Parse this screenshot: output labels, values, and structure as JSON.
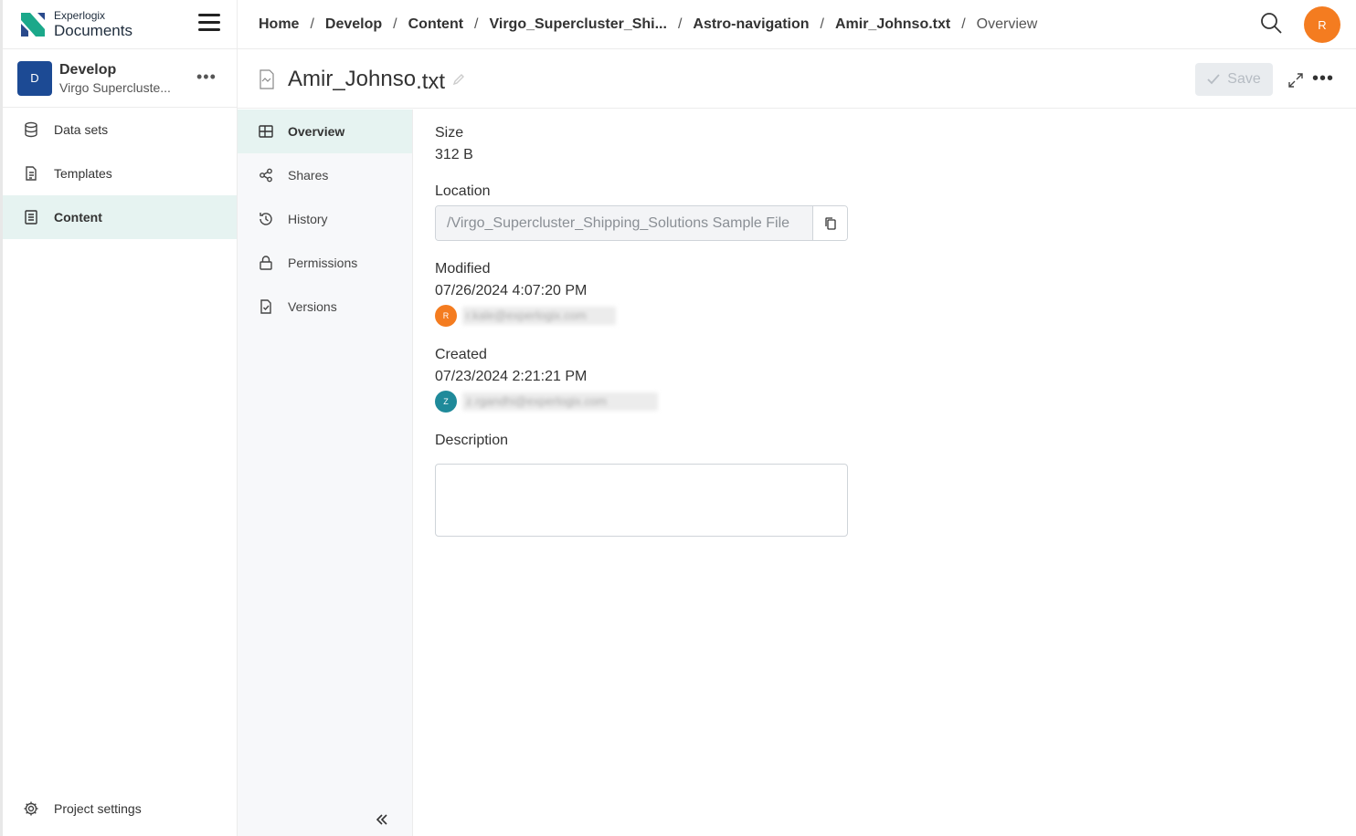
{
  "brand": {
    "line1": "Experlogix",
    "line2": "Documents"
  },
  "project": {
    "initial": "D",
    "title": "Develop",
    "subtitle": "Virgo Superclust​e..."
  },
  "sidebar": {
    "items": [
      {
        "label": "Data sets",
        "icon": "database-icon"
      },
      {
        "label": "Templates",
        "icon": "document-icon"
      },
      {
        "label": "Content",
        "icon": "content-icon",
        "active": true
      }
    ],
    "bottom": {
      "label": "Project settings",
      "icon": "gear-icon"
    }
  },
  "breadcrumb": [
    "Home",
    "Develop",
    "Content",
    "Virgo_Supercluster_Shi...",
    "Astro-navigation",
    "Amir_Johnso.txt",
    "Overview"
  ],
  "user": {
    "initial": "R"
  },
  "file": {
    "name": "Amir_Johnso",
    "ext": ".txt"
  },
  "toolbar": {
    "save_label": "Save"
  },
  "subnav": {
    "items": [
      {
        "label": "Overview",
        "active": true
      },
      {
        "label": "Shares"
      },
      {
        "label": "History"
      },
      {
        "label": "Permissions"
      },
      {
        "label": "Versions"
      }
    ]
  },
  "details": {
    "size_label": "Size",
    "size_value": "312 B",
    "location_label": "Location",
    "location_value": "/Virgo_Supercluster_Shipping_Solutions Sample File",
    "modified_label": "Modified",
    "modified_value": "07/26/2024 4:07:20 PM",
    "modified_user_initial": "R",
    "modified_user_email": "r.kale@experlogix.com",
    "created_label": "Created",
    "created_value": "07/23/2024 2:21:21 PM",
    "created_user_initial": "Z",
    "created_user_email": "z.rgandhi@experlogix.com",
    "description_label": "Description",
    "description_value": ""
  },
  "colors": {
    "accent": "#f47c20",
    "project_avatar": "#1c4a94",
    "active_bg": "#e6f3f1",
    "created_avatar": "#1f8a9a"
  }
}
